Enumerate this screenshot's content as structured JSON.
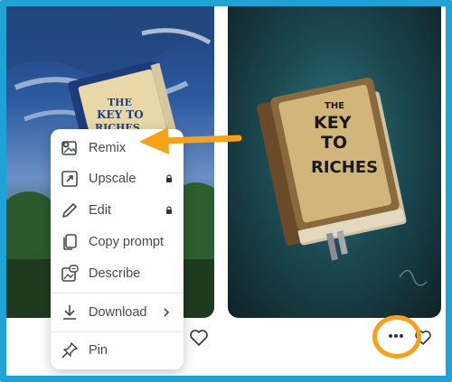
{
  "menu": {
    "items": [
      {
        "label": "Remix",
        "icon": "remix-icon"
      },
      {
        "label": "Upscale",
        "icon": "upscale-icon",
        "locked": true
      },
      {
        "label": "Edit",
        "icon": "pencil-icon",
        "locked": true
      },
      {
        "label": "Copy prompt",
        "icon": "copy-icon"
      },
      {
        "label": "Describe",
        "icon": "describe-icon"
      },
      {
        "label": "Download",
        "icon": "download-icon",
        "submenu": true
      },
      {
        "label": "Pin",
        "icon": "pin-icon"
      }
    ]
  },
  "cards": {
    "left": {
      "book_text": [
        "THE",
        "KEY TO",
        "RICHES"
      ]
    },
    "right": {
      "book_text": [
        "THE",
        "KEY",
        "TO",
        "RICHES"
      ]
    }
  },
  "colors": {
    "frame": "#1fa3d6",
    "highlight": "#f5a218",
    "menu_text": "#444a55"
  }
}
